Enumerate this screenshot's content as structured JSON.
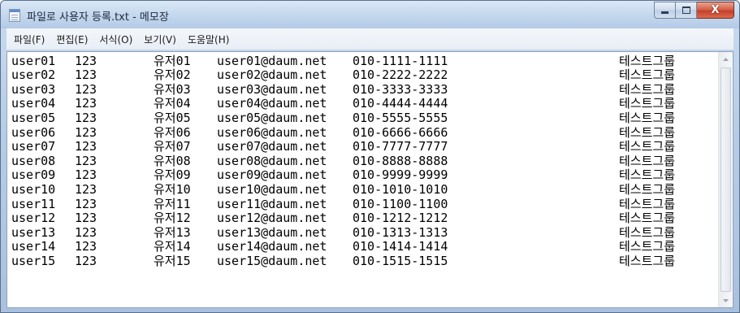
{
  "window": {
    "title": "파일로 사용자 등록.txt - 메모장",
    "accent": "#b3cae6",
    "close_color": "#c6402a"
  },
  "title_buttons": {
    "minimize_icon": "minimize-icon",
    "maximize_icon": "maximize-icon",
    "close_icon": "close-icon",
    "close_glyph": "X"
  },
  "menu": {
    "items": [
      {
        "label": "파일(F)"
      },
      {
        "label": "편집(E)"
      },
      {
        "label": "서식(O)"
      },
      {
        "label": "보기(V)"
      },
      {
        "label": "도움말(H)"
      }
    ]
  },
  "document": {
    "lines": [
      {
        "id": "user01",
        "pw": "123",
        "name": "유저01",
        "email": "user01@daum.net",
        "phone": "010-1111-1111",
        "group": "테스트그룹"
      },
      {
        "id": "user02",
        "pw": "123",
        "name": "유저02",
        "email": "user02@daum.net",
        "phone": "010-2222-2222",
        "group": "테스트그룹"
      },
      {
        "id": "user03",
        "pw": "123",
        "name": "유저03",
        "email": "user03@daum.net",
        "phone": "010-3333-3333",
        "group": "테스트그룹"
      },
      {
        "id": "user04",
        "pw": "123",
        "name": "유저04",
        "email": "user04@daum.net",
        "phone": "010-4444-4444",
        "group": "테스트그룹"
      },
      {
        "id": "user05",
        "pw": "123",
        "name": "유저05",
        "email": "user05@daum.net",
        "phone": "010-5555-5555",
        "group": "테스트그룹"
      },
      {
        "id": "user06",
        "pw": "123",
        "name": "유저06",
        "email": "user06@daum.net",
        "phone": "010-6666-6666",
        "group": "테스트그룹"
      },
      {
        "id": "user07",
        "pw": "123",
        "name": "유저07",
        "email": "user07@daum.net",
        "phone": "010-7777-7777",
        "group": "테스트그룹"
      },
      {
        "id": "user08",
        "pw": "123",
        "name": "유저08",
        "email": "user08@daum.net",
        "phone": "010-8888-8888",
        "group": "테스트그룹"
      },
      {
        "id": "user09",
        "pw": "123",
        "name": "유저09",
        "email": "user09@daum.net",
        "phone": "010-9999-9999",
        "group": "테스트그룹"
      },
      {
        "id": "user10",
        "pw": "123",
        "name": "유저10",
        "email": "user10@daum.net",
        "phone": "010-1010-1010",
        "group": "테스트그룹"
      },
      {
        "id": "user11",
        "pw": "123",
        "name": "유저11",
        "email": "user11@daum.net",
        "phone": "010-1100-1100",
        "group": "테스트그룹"
      },
      {
        "id": "user12",
        "pw": "123",
        "name": "유저12",
        "email": "user12@daum.net",
        "phone": "010-1212-1212",
        "group": "테스트그룹"
      },
      {
        "id": "user13",
        "pw": "123",
        "name": "유저13",
        "email": "user13@daum.net",
        "phone": "010-1313-1313",
        "group": "테스트그룹"
      },
      {
        "id": "user14",
        "pw": "123",
        "name": "유저14",
        "email": "user14@daum.net",
        "phone": "010-1414-1414",
        "group": "테스트그룹"
      },
      {
        "id": "user15",
        "pw": "123",
        "name": "유저15",
        "email": "user15@daum.net",
        "phone": "010-1515-1515",
        "group": "테스트그룹"
      }
    ]
  },
  "scrollbar": {
    "up_icon": "scroll-up-arrow-icon",
    "down_icon": "scroll-down-arrow-icon"
  }
}
